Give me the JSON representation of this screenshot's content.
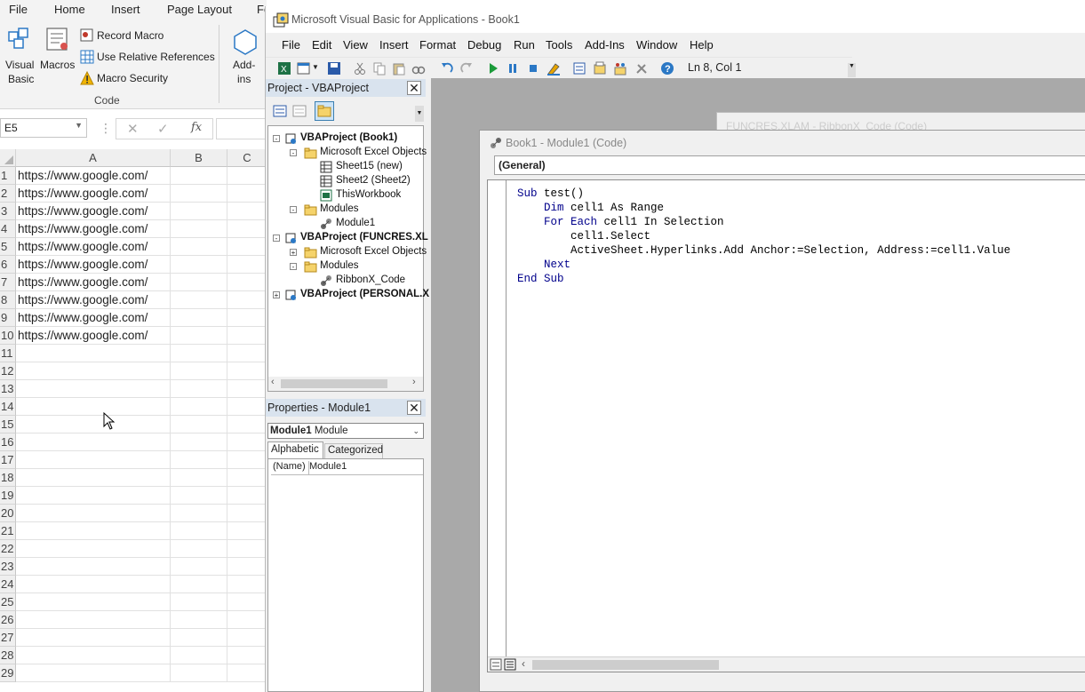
{
  "excel": {
    "tabs": [
      "File",
      "Home",
      "Insert",
      "Page Layout",
      "Fo"
    ],
    "ribbon": {
      "visual_basic": [
        "Visual",
        "Basic"
      ],
      "macros": "Macros",
      "record_macro": "Record Macro",
      "relative_refs": "Use Relative References",
      "macro_security": "Macro Security",
      "addins": [
        "Add-",
        "ins"
      ],
      "group_label": "Code"
    },
    "name_box": "E5",
    "fx": "fx",
    "columns": [
      "A",
      "B",
      "C"
    ],
    "rows": [
      "1",
      "2",
      "3",
      "4",
      "5",
      "6",
      "7",
      "8",
      "9",
      "10",
      "11",
      "12",
      "13",
      "14",
      "15",
      "16",
      "17",
      "18",
      "19",
      "20",
      "21",
      "22",
      "23",
      "24",
      "25",
      "26",
      "27",
      "28",
      "29"
    ],
    "cells_a": [
      "https://www.google.com/",
      "https://www.google.com/",
      "https://www.google.com/",
      "https://www.google.com/",
      "https://www.google.com/",
      "https://www.google.com/",
      "https://www.google.com/",
      "https://www.google.com/",
      "https://www.google.com/",
      "https://www.google.com/"
    ]
  },
  "vbe": {
    "title": "Microsoft Visual Basic for Applications - Book1",
    "menu": [
      "File",
      "Edit",
      "View",
      "Insert",
      "Format",
      "Debug",
      "Run",
      "Tools",
      "Add-Ins",
      "Window",
      "Help"
    ],
    "status": "Ln 8, Col 1",
    "project_panel_title": "Project - VBAProject",
    "tree": [
      {
        "label": "VBAProject (Book1)",
        "bold": true
      },
      {
        "label": "Microsoft Excel Objects",
        "bold": false
      },
      {
        "label": "Sheet15 (new)",
        "bold": false
      },
      {
        "label": "Sheet2 (Sheet2)",
        "bold": false
      },
      {
        "label": "ThisWorkbook",
        "bold": false
      },
      {
        "label": "Modules",
        "bold": false
      },
      {
        "label": "Module1",
        "bold": false
      },
      {
        "label": "VBAProject (FUNCRES.XL",
        "bold": true
      },
      {
        "label": "Microsoft Excel Objects",
        "bold": false
      },
      {
        "label": "Modules",
        "bold": false
      },
      {
        "label": "RibbonX_Code",
        "bold": false
      },
      {
        "label": "VBAProject (PERSONAL.X",
        "bold": true
      }
    ],
    "properties_title": "Properties - Module1",
    "properties_select": {
      "name": "Module1",
      "type": "Module"
    },
    "properties_tabs": [
      "Alphabetic",
      "Categorized"
    ],
    "properties_row": {
      "key": "(Name)",
      "value": "Module1"
    },
    "background_window_title": "FUNCRES.XLAM - RibbonX_Code (Code)",
    "code_window_title": "Book1 - Module1 (Code)",
    "object_dropdown": "(General)",
    "code": [
      {
        "kw": "Sub",
        "rest": " test()",
        "indent": ""
      },
      {
        "kw": "Dim",
        "rest": " cell1 As Range",
        "indent": "    "
      },
      {
        "kw": "For Each",
        "rest": " cell1 In Selection",
        "indent": "    "
      },
      {
        "kw": "",
        "rest": "cell1.Select",
        "indent": "        "
      },
      {
        "kw": "",
        "rest": "ActiveSheet.Hyperlinks.Add Anchor:=Selection, Address:=cell1.Value",
        "indent": "        "
      },
      {
        "kw": "Next",
        "rest": "",
        "indent": "    "
      },
      {
        "kw": "End Sub",
        "rest": "",
        "indent": ""
      }
    ]
  }
}
